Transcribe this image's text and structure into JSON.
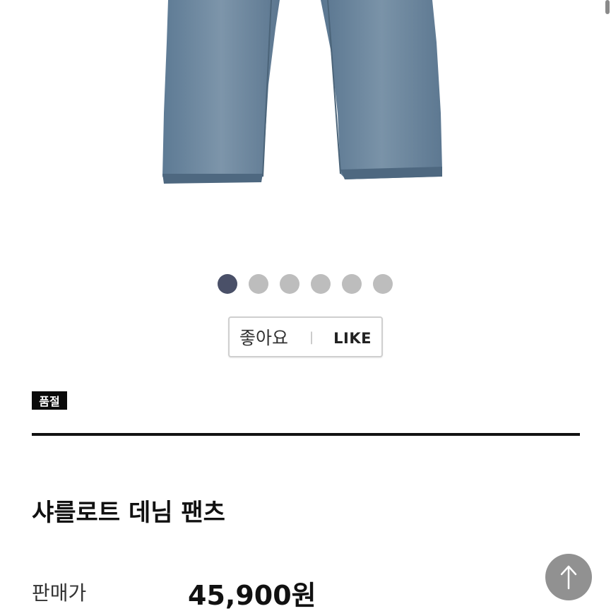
{
  "gallery": {
    "slide_count": 6,
    "active_index": 0,
    "colors": {
      "active": "#4a5068",
      "inactive": "#bdbdbd"
    }
  },
  "like_button": {
    "label_ko": "좋아요",
    "separator": "|",
    "label_en": "LIKE"
  },
  "badge": {
    "soldout_label": "품절"
  },
  "product": {
    "name": "샤를로트 데님 팬츠"
  },
  "price": {
    "label": "판매가",
    "value": "45,900원"
  },
  "icons": {
    "scroll_top": "arrow-up-icon"
  }
}
